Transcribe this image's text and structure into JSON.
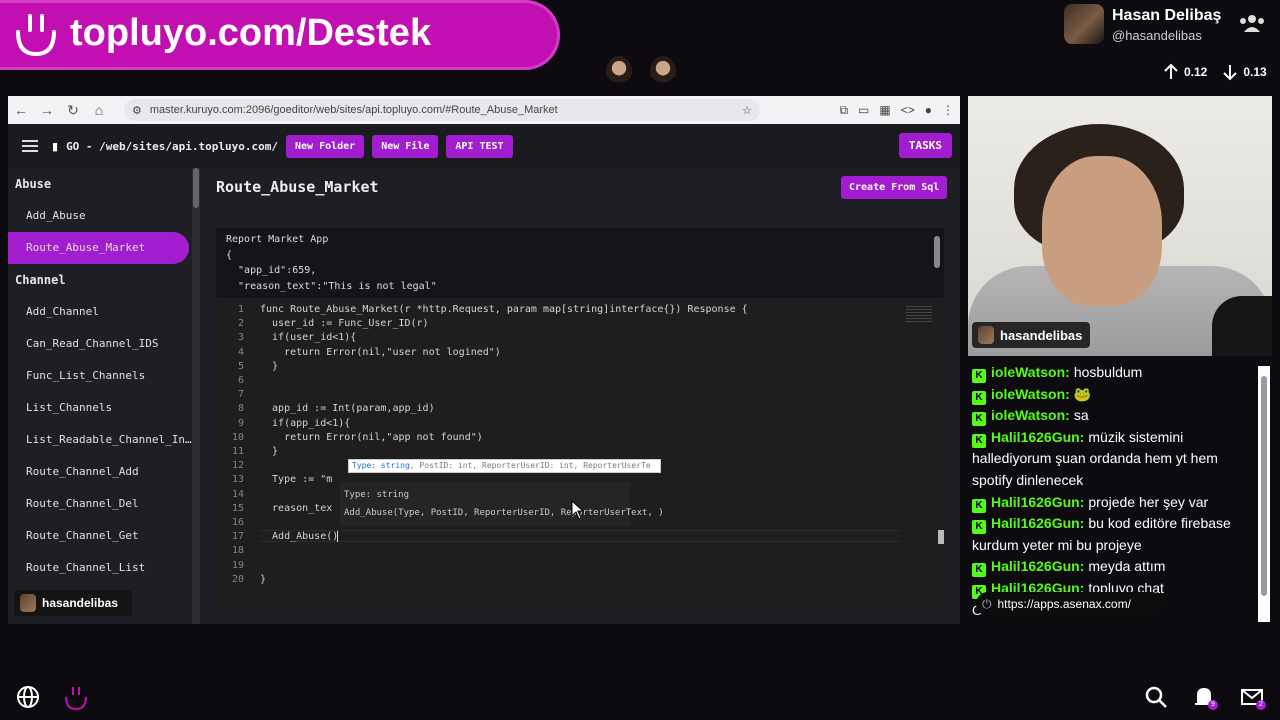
{
  "overlay": {
    "brand_text": "topluyo.com/Destek",
    "profile_name": "Hasan Delibaş",
    "profile_handle": "@hasandelibas",
    "stat_up": "0.12",
    "stat_down": "0.13"
  },
  "browser": {
    "url": "master.kuruyo.com:2096/goeditor/web/sites/api.topluyo.com/#Route_Abuse_Market"
  },
  "app_bar": {
    "path": "GO - /web/sites/api.topluyo.com/",
    "buttons": [
      "New Folder",
      "New File",
      "API TEST"
    ],
    "tasks": "TASKS"
  },
  "sidebar": {
    "groups": [
      {
        "label": "Abuse",
        "items": [
          {
            "label": "Add_Abuse",
            "active": false
          },
          {
            "label": "Route_Abuse_Market",
            "active": true
          }
        ]
      },
      {
        "label": "Channel",
        "items": [
          {
            "label": "Add_Channel",
            "active": false
          },
          {
            "label": "Can_Read_Channel_IDS",
            "active": false
          },
          {
            "label": "Func_List_Channels",
            "active": false
          },
          {
            "label": "List_Channels",
            "active": false
          },
          {
            "label": "List_Readable_Channel_In…",
            "active": false
          },
          {
            "label": "Route_Channel_Add",
            "active": false
          },
          {
            "label": "Route_Channel_Del",
            "active": false
          },
          {
            "label": "Route_Channel_Get",
            "active": false
          },
          {
            "label": "Route_Channel_List",
            "active": false
          }
        ]
      }
    ],
    "user_chip": "hasandelibas"
  },
  "main": {
    "title": "Route_Abuse_Market",
    "create_sql": "Create From Sql",
    "example_lines": [
      "Report Market App",
      "{",
      "  \"app_id\":659,",
      "  \"reason_text\":\"This is not legal\""
    ]
  },
  "editor": {
    "line_numbers": [
      "1",
      "2",
      "3",
      "4",
      "5",
      "6",
      "7",
      "8",
      "9",
      "10",
      "11",
      "12",
      "13",
      "14",
      "15",
      "16",
      "17",
      "18",
      "19",
      "20"
    ],
    "lines": [
      "func Route_Abuse_Market(r *http.Request, param map[string]interface{}) Response {",
      "  user_id := Func_User_ID(r)",
      "  if(user_id<1){",
      "    return Error(nil,\"user not logined\")",
      "  }",
      "",
      "",
      "  app_id := Int(param,app_id)",
      "  if(app_id<1){",
      "    return Error(nil,\"app not found\")",
      "  }",
      "",
      "  Type := \"m",
      "",
      "  reason_tex",
      "",
      "  Add_Abuse()",
      "",
      "",
      "}"
    ],
    "hint_type": "Type: string",
    "hint_rest": ", PostID: int, ReporterUserID: int, ReporterUserTe",
    "popup_type": "Type: string",
    "popup_signature": "Add_Abuse(Type, PostID, ReporterUserID, ReporterUserText, )"
  },
  "stream": {
    "cam_name": "hasandelibas",
    "messages": [
      {
        "user": "ioleWatson:",
        "text": "hosbuldum"
      },
      {
        "user": "ioleWatson:",
        "text": "🐸"
      },
      {
        "user": "ioleWatson:",
        "text": "sa"
      },
      {
        "user": "Halil1626Gun:",
        "text": "müzik sistemini hallediyorum şuan ordanda hem yt hem spotify dinlenecek"
      },
      {
        "user": "Halil1626Gun:",
        "text": "projede her şey var"
      },
      {
        "user": "Halil1626Gun:",
        "text": "bu kod editöre firebase kurdum yeter mi bu projeye"
      },
      {
        "user": "Halil1626Gun:",
        "text": "meyda attım"
      },
      {
        "user": "Halil1626Gun:",
        "text": "topluyo chat"
      },
      {
        "user": "",
        "text": "OHOFIGTH"
      }
    ],
    "link": "https://apps.asenax.com/",
    "notif_count": "9",
    "mail_count": "2"
  },
  "colors": {
    "accent": "#a21cd0",
    "brand": "#c20fb1",
    "chat_user": "#53fc18"
  }
}
